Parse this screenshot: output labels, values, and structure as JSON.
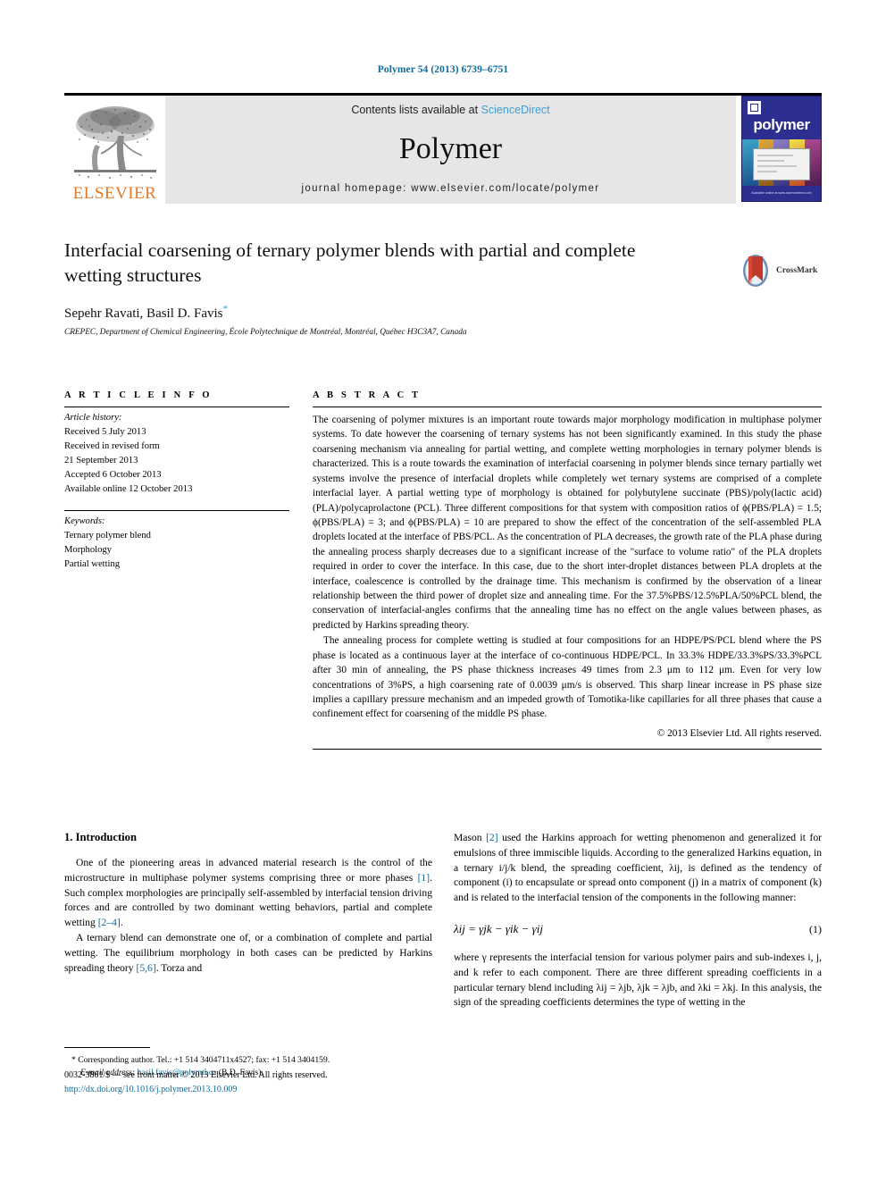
{
  "running_head": "Polymer 54 (2013) 6739–6751",
  "masthead": {
    "publisher_logo_label": "ELSEVIER",
    "contents_prefix": "Contents lists available at ",
    "contents_link": "ScienceDirect",
    "journal_name": "Polymer",
    "homepage": "journal homepage: www.elsevier.com/locate/polymer",
    "cover": {
      "title": "polymer",
      "footer": "Available online at www.sciencedirect.com"
    }
  },
  "article": {
    "title": "Interfacial coarsening of ternary polymer blends with partial and complete wetting structures",
    "authors": "Sepehr Ravati, Basil D. Favis",
    "author_marker": "*",
    "affiliation": "CREPEC, Department of Chemical Engineering, École Polytechnique de Montréal, Montréal, Québec H3C3A7, Canada",
    "crossmark_label": "CrossMark"
  },
  "article_info": {
    "heading": "A R T I C L E   I N F O",
    "history_label": "Article history:",
    "history": [
      "Received 5 July 2013",
      "Received in revised form",
      "21 September 2013",
      "Accepted 6 October 2013",
      "Available online 12 October 2013"
    ],
    "keywords_label": "Keywords:",
    "keywords": [
      "Ternary polymer blend",
      "Morphology",
      "Partial wetting"
    ]
  },
  "abstract": {
    "heading": "A B S T R A C T",
    "paragraph1": "The coarsening of polymer mixtures is an important route towards major morphology modification in multiphase polymer systems. To date however the coarsening of ternary systems has not been significantly examined. In this study the phase coarsening mechanism via annealing for partial wetting, and complete wetting morphologies in ternary polymer blends is characterized. This is a route towards the examination of interfacial coarsening in polymer blends since ternary partially wet systems involve the presence of interfacial droplets while completely wet ternary systems are comprised of a complete interfacial layer. A partial wetting type of morphology is obtained for polybutylene succinate (PBS)/poly(lactic acid) (PLA)/polycaprolactone (PCL). Three different compositions for that system with composition ratios of ϕ(PBS/PLA) = 1.5; ϕ(PBS/PLA) = 3; and ϕ(PBS/PLA) = 10 are prepared to show the effect of the concentration of the self-assembled PLA droplets located at the interface of PBS/PCL. As the concentration of PLA decreases, the growth rate of the PLA phase during the annealing process sharply decreases due to a significant increase of the \"surface to volume ratio\" of the PLA droplets required in order to cover the interface. In this case, due to the short inter-droplet distances between PLA droplets at the interface, coalescence is controlled by the drainage time. This mechanism is confirmed by the observation of a linear relationship between the third power of droplet size and annealing time. For the 37.5%PBS/12.5%PLA/50%PCL blend, the conservation of interfacial-angles confirms that the annealing time has no effect on the angle values between phases, as predicted by Harkins spreading theory.",
    "paragraph2": "The annealing process for complete wetting is studied at four compositions for an HDPE/PS/PCL blend where the PS phase is located as a continuous layer at the interface of co-continuous HDPE/PCL. In 33.3% HDPE/33.3%PS/33.3%PCL after 30 min of annealing, the PS phase thickness increases 49 times from 2.3 μm to 112 μm. Even for very low concentrations of 3%PS, a high coarsening rate of 0.0039 μm/s is observed. This sharp linear increase in PS phase size implies a capillary pressure mechanism and an impeded growth of Tomotika-like capillaries for all three phases that cause a confinement effect for coarsening of the middle PS phase.",
    "copyright": "© 2013 Elsevier Ltd. All rights reserved."
  },
  "introduction": {
    "heading": "1. Introduction",
    "left_paragraph_1_a": "One of the pioneering areas in advanced material research is the control of the microstructure in multiphase polymer systems comprising three or more phases ",
    "left_ref_1": "[1]",
    "left_paragraph_1_b": ". Such complex morphologies are principally self-assembled by interfacial tension driving forces and are controlled by two dominant wetting behaviors, partial and complete wetting ",
    "left_ref_2": "[2–4]",
    "left_paragraph_1_c": ".",
    "left_paragraph_2_a": "A ternary blend can demonstrate one of, or a combination of complete and partial wetting. The equilibrium morphology in both cases can be predicted by Harkins spreading theory ",
    "left_ref_3": "[5,6]",
    "left_paragraph_2_b": ". Torza and",
    "right_paragraph_1_a": "Mason ",
    "right_ref_1": "[2]",
    "right_paragraph_1_b": " used the Harkins approach for wetting phenomenon and generalized it for emulsions of three immiscible liquids. According to the generalized Harkins equation, in a ternary i/j/k blend, the spreading coefficient, λij, is defined as the tendency of component (i) to encapsulate or spread onto component (j) in a matrix of component (k) and is related to the interfacial tension of the components in the following manner:",
    "equation_1": "λij = γjk − γik − γij",
    "equation_1_number": "(1)",
    "right_paragraph_2": "where γ represents the interfacial tension for various polymer pairs and sub-indexes i, j, and k refer to each component. There are three different spreading coefficients in a particular ternary blend including λij = λjb, λjk = λjb, and λki = λkj. In this analysis, the sign of the spreading coefficients determines the type of wetting in the"
  },
  "footnote": {
    "star": "*",
    "corresponding": " Corresponding author. Tel.: +1 514 3404711x4527; fax: +1 514 3404159.",
    "email_label": "E-mail address:",
    "email": "basil.favis@polymtl.ca",
    "email_suffix": " (B.D. Favis)."
  },
  "footer": {
    "issn_line": "0032-3861/$ — see front matter © 2013 Elsevier Ltd. All rights reserved.",
    "doi": "http://dx.doi.org/10.1016/j.polymer.2013.10.009"
  },
  "colors": {
    "link_blue": "#0b6b9b",
    "sciencedirect_blue": "#3f9ed1",
    "elsevier_orange": "#E87722",
    "cover_navy": "#2c2f8f"
  }
}
